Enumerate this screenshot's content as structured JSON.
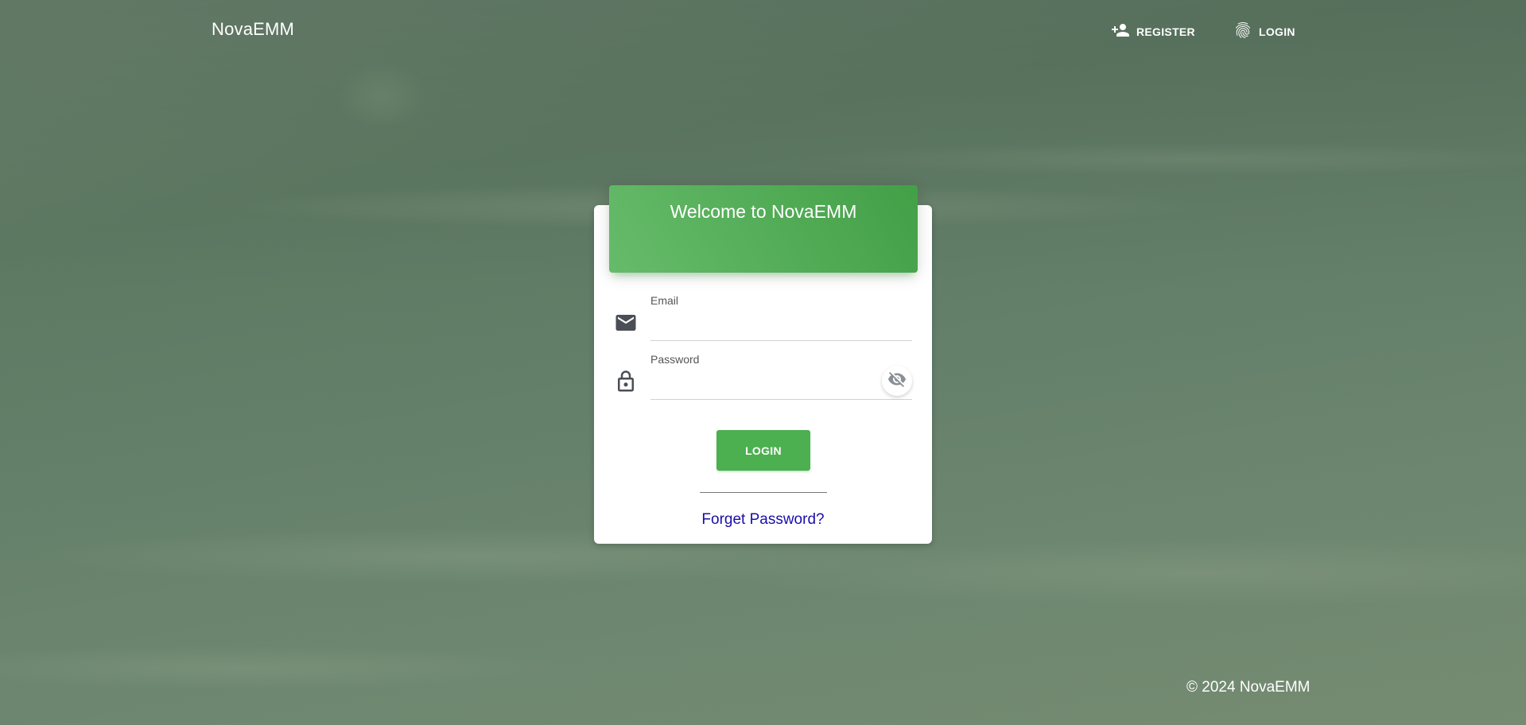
{
  "app": {
    "brand": "NovaEMM"
  },
  "nav": {
    "register_label": "REGISTER",
    "register_icon": "person-add-icon",
    "login_label": "LOGIN",
    "login_icon": "fingerprint-icon"
  },
  "login_card": {
    "title": "Welcome to NovaEMM",
    "header_color": "#4caf50",
    "email": {
      "label": "Email",
      "value": "",
      "icon": "mail-icon"
    },
    "password": {
      "label": "Password",
      "value": "",
      "icon": "lock-icon",
      "toggle_icon": "visibility-off-icon"
    },
    "submit_label": "LOGIN",
    "forgot_label": "Forget Password?",
    "link_color": "#1a0dab"
  },
  "footer": {
    "copyright": "© 2024 NovaEMM"
  }
}
